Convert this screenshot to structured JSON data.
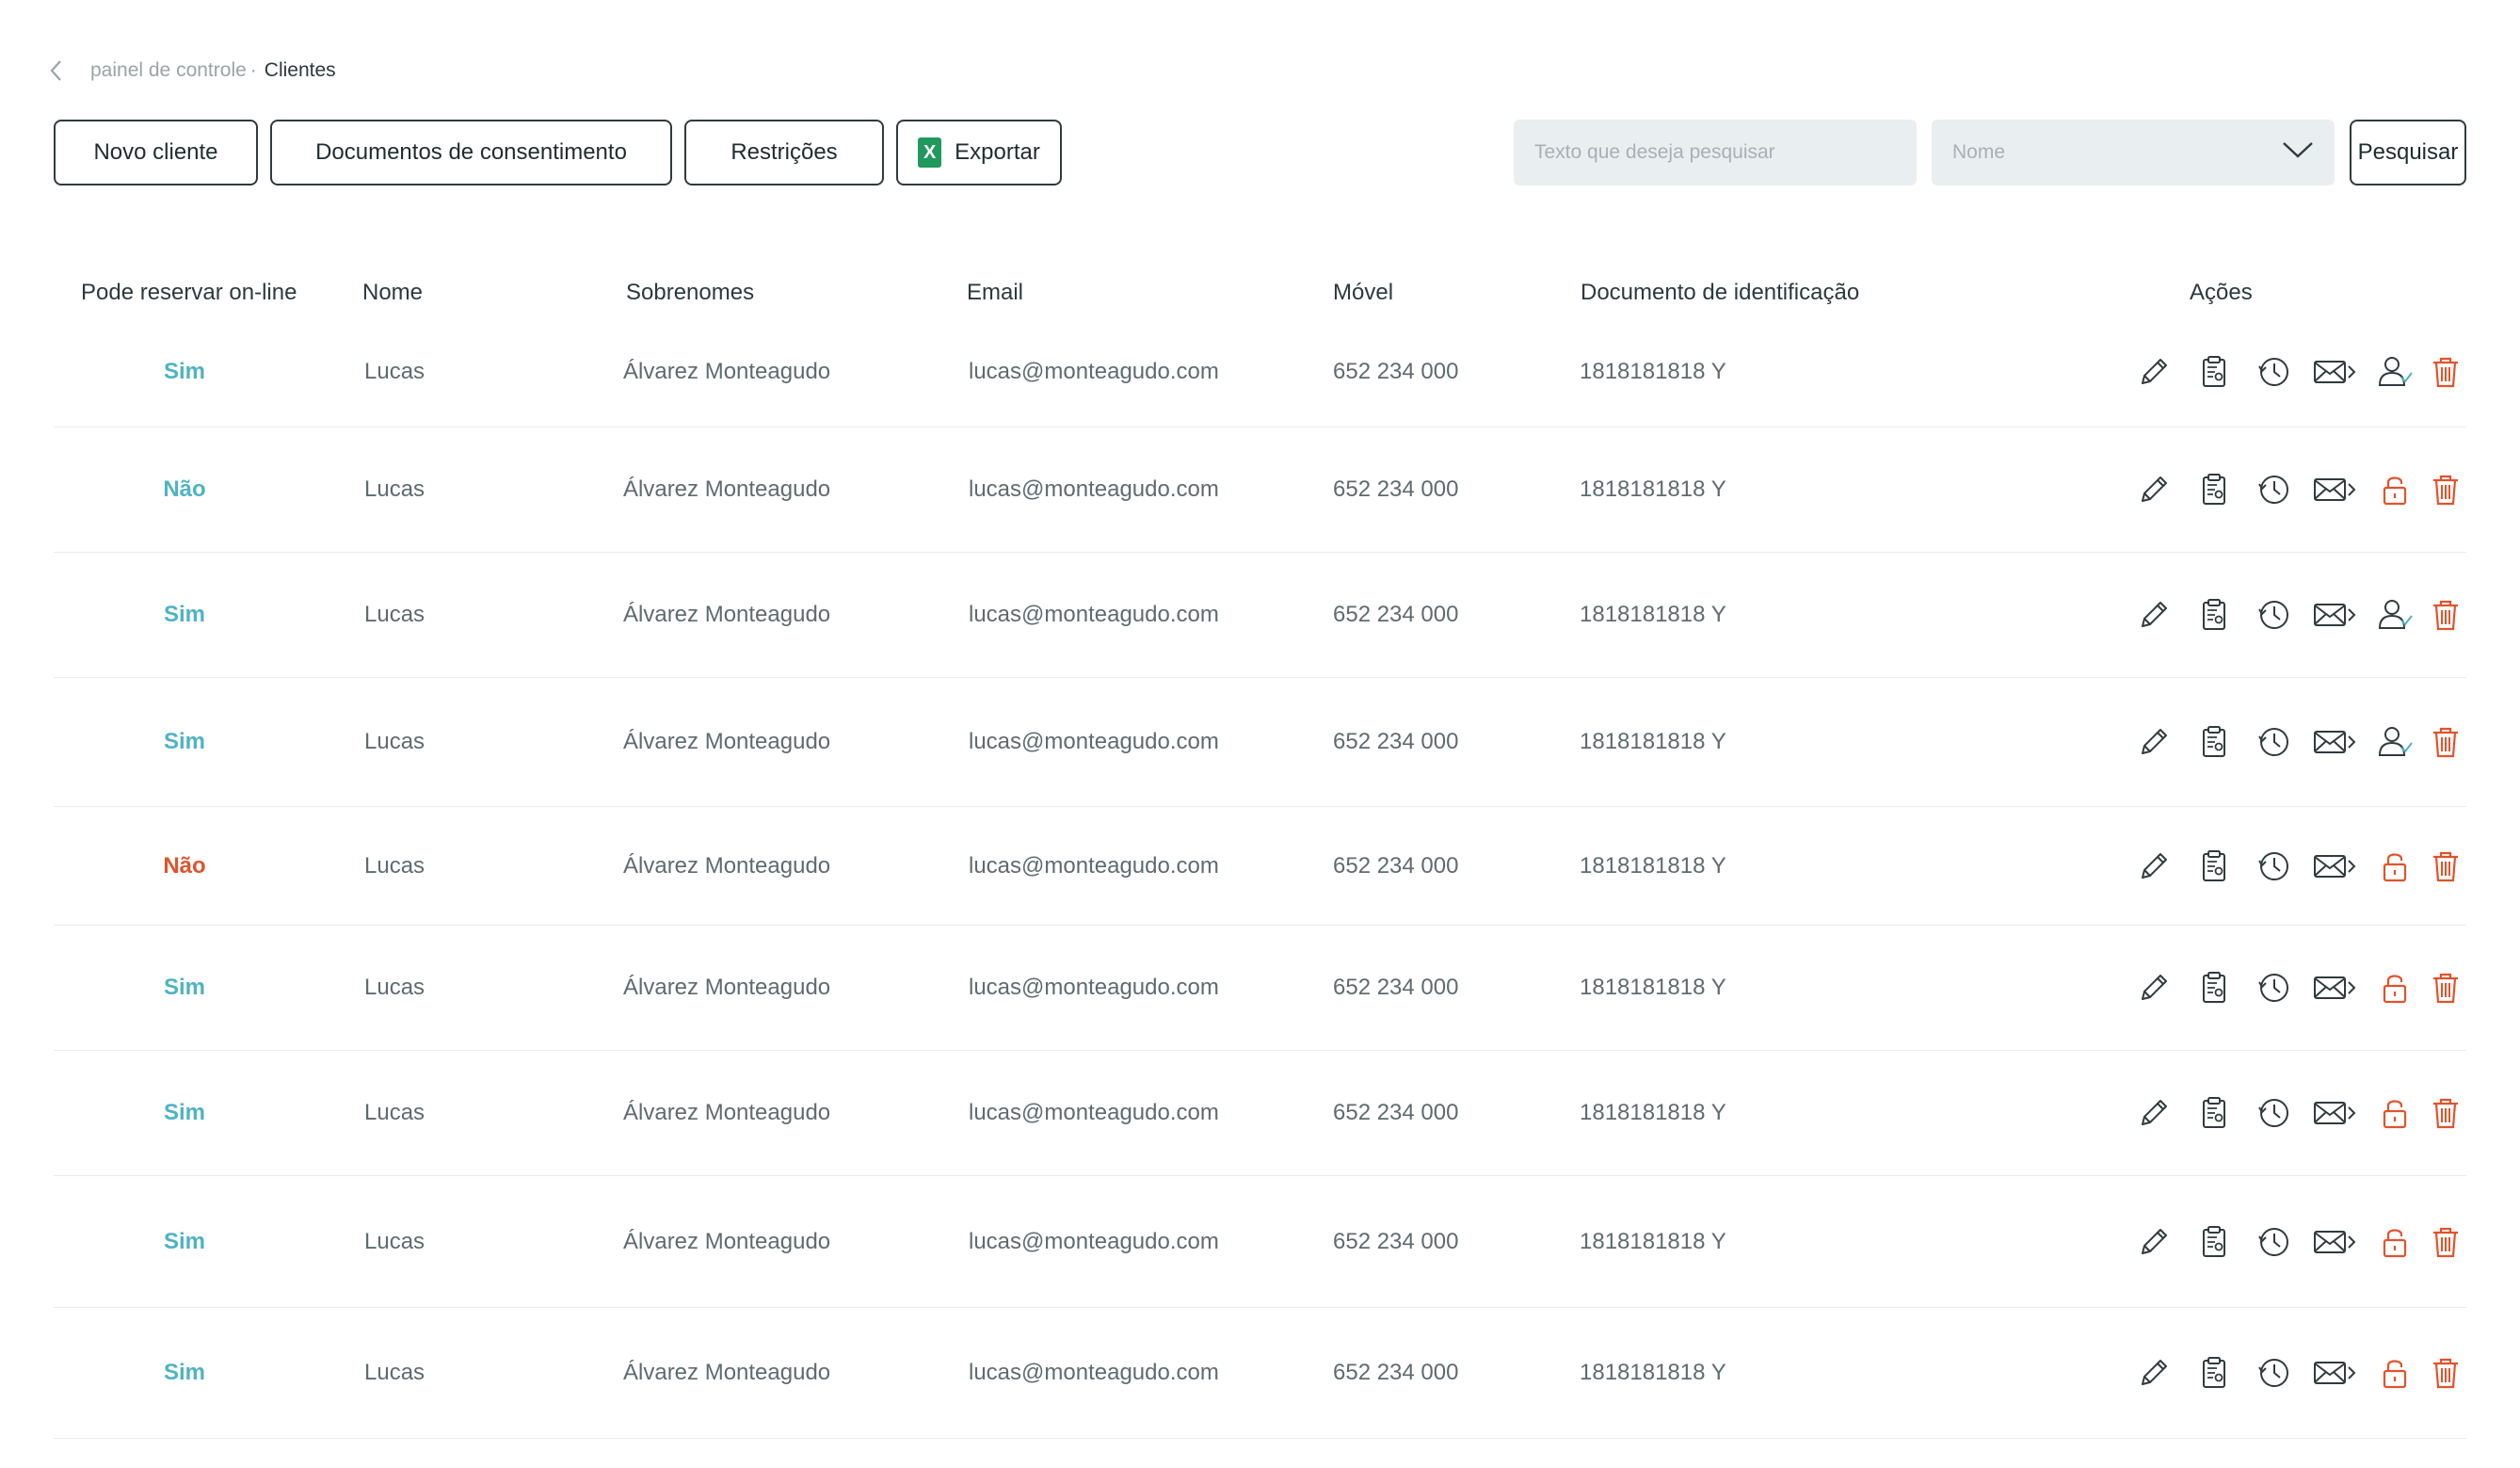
{
  "breadcrumb": {
    "parent": "painel de controle",
    "separator": "·",
    "current": "Clientes"
  },
  "toolbar": {
    "new_client": "Novo cliente",
    "consent_docs": "Documentos de consentimento",
    "restrictions": "Restrições",
    "export": "Exportar",
    "export_badge": "X"
  },
  "search": {
    "placeholder": "Texto que deseja pesquisar",
    "field_value": "Nome",
    "button": "Pesquisar"
  },
  "table": {
    "headers": {
      "online": "Pode reservar on-line",
      "name": "Nome",
      "surnames": "Sobrenomes",
      "email": "Email",
      "mobile": "Móvel",
      "id_doc": "Documento de identificação",
      "actions": "Ações"
    },
    "rows": [
      {
        "online": "Sim",
        "online_status": "ok",
        "name": "Lucas",
        "surnames": "Álvarez Monteagudo",
        "email": "lucas@monteagudo.com",
        "mobile": "652 234 000",
        "id_doc": "1818181818 Y",
        "account_icon": "user-check"
      },
      {
        "online": "Não",
        "online_status": "ok",
        "name": "Lucas",
        "surnames": "Álvarez Monteagudo",
        "email": "lucas@monteagudo.com",
        "mobile": "652 234 000",
        "id_doc": "1818181818 Y",
        "account_icon": "lock"
      },
      {
        "online": "Sim",
        "online_status": "ok",
        "name": "Lucas",
        "surnames": "Álvarez Monteagudo",
        "email": "lucas@monteagudo.com",
        "mobile": "652 234 000",
        "id_doc": "1818181818 Y",
        "account_icon": "user-check"
      },
      {
        "online": "Sim",
        "online_status": "ok",
        "name": "Lucas",
        "surnames": "Álvarez Monteagudo",
        "email": "lucas@monteagudo.com",
        "mobile": "652 234 000",
        "id_doc": "1818181818 Y",
        "account_icon": "user-check"
      },
      {
        "online": "Não",
        "online_status": "no",
        "name": "Lucas",
        "surnames": "Álvarez Monteagudo",
        "email": "lucas@monteagudo.com",
        "mobile": "652 234 000",
        "id_doc": "1818181818 Y",
        "account_icon": "lock"
      },
      {
        "online": "Sim",
        "online_status": "ok",
        "name": "Lucas",
        "surnames": "Álvarez Monteagudo",
        "email": "lucas@monteagudo.com",
        "mobile": "652 234 000",
        "id_doc": "1818181818 Y",
        "account_icon": "lock"
      },
      {
        "online": "Sim",
        "online_status": "ok",
        "name": "Lucas",
        "surnames": "Álvarez Monteagudo",
        "email": "lucas@monteagudo.com",
        "mobile": "652 234 000",
        "id_doc": "1818181818 Y",
        "account_icon": "lock"
      },
      {
        "online": "Sim",
        "online_status": "ok",
        "name": "Lucas",
        "surnames": "Álvarez Monteagudo",
        "email": "lucas@monteagudo.com",
        "mobile": "652 234 000",
        "id_doc": "1818181818 Y",
        "account_icon": "lock"
      },
      {
        "online": "Sim",
        "online_status": "ok",
        "name": "Lucas",
        "surnames": "Álvarez Monteagudo",
        "email": "lucas@monteagudo.com",
        "mobile": "652 234 000",
        "id_doc": "1818181818 Y",
        "account_icon": "lock"
      }
    ]
  },
  "icons": [
    "chevron-left-icon",
    "excel-icon",
    "chevron-down-icon",
    "pencil-icon",
    "clipboard-icon",
    "history-icon",
    "mail-send-icon",
    "user-check-icon",
    "lock-icon",
    "trash-icon"
  ],
  "colors": {
    "ok": "#4fb3c4",
    "no": "#e0532c",
    "danger": "#e0532c",
    "icon": "#2f3b3d",
    "excel": "#1f9a5c",
    "input_bg": "#e9eef0"
  }
}
